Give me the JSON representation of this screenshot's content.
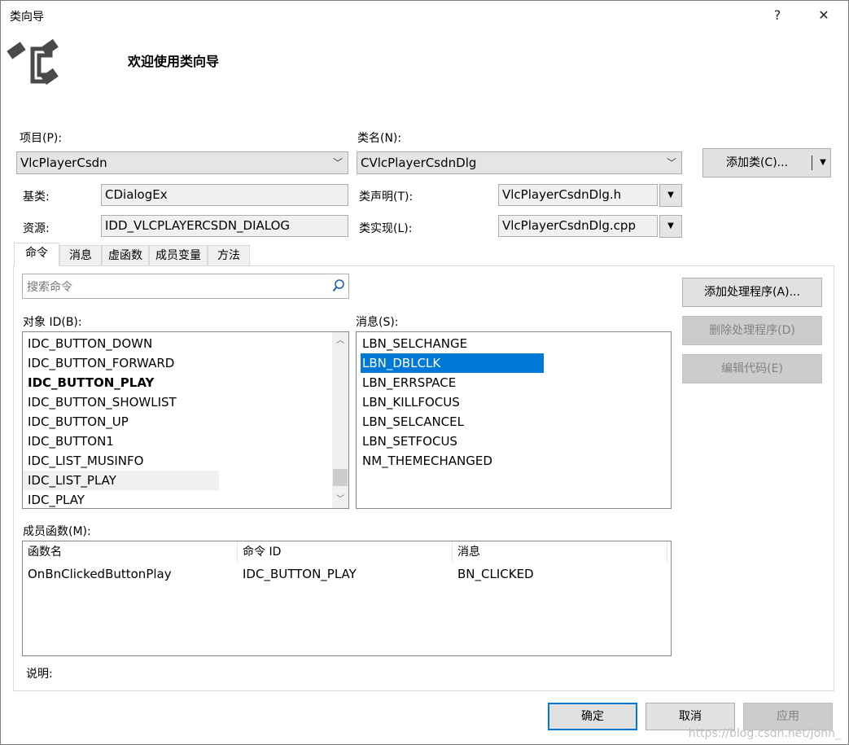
{
  "window": {
    "title": "类向导",
    "help_label": "?",
    "close_label": "✕",
    "heading": "欢迎使用类向导"
  },
  "project": {
    "label": "项目(P):",
    "value": "VlcPlayerCsdn"
  },
  "class_name": {
    "label": "类名(N):",
    "value": "CVlcPlayerCsdnDlg"
  },
  "add_class": {
    "label": "添加类(C)..."
  },
  "base_class": {
    "label": "基类:",
    "value": "CDialogEx"
  },
  "resource": {
    "label": "资源:",
    "value": "IDD_VLCPLAYERCSDN_DIALOG"
  },
  "class_decl": {
    "label": "类声明(T):",
    "value": "VlcPlayerCsdnDlg.h"
  },
  "class_impl": {
    "label": "类实现(L):",
    "value": "VlcPlayerCsdnDlg.cpp"
  },
  "tabs": [
    {
      "label": "命令",
      "active": true
    },
    {
      "label": "消息"
    },
    {
      "label": "虚函数"
    },
    {
      "label": "成员变量"
    },
    {
      "label": "方法"
    }
  ],
  "search": {
    "placeholder": "搜索命令"
  },
  "object_ids": {
    "label": "对象 ID(B):",
    "items": [
      "IDC_BUTTON_DOWN",
      "IDC_BUTTON_FORWARD",
      "IDC_BUTTON_PLAY",
      "IDC_BUTTON_SHOWLIST",
      "IDC_BUTTON_UP",
      "IDC_BUTTON1",
      "IDC_LIST_MUSINFO",
      "IDC_LIST_PLAY",
      "IDC_PLAY"
    ],
    "bold_item": "IDC_BUTTON_PLAY",
    "hover_item": "IDC_LIST_PLAY"
  },
  "messages": {
    "label": "消息(S):",
    "items": [
      "LBN_SELCHANGE",
      "LBN_DBLCLK",
      "LBN_ERRSPACE",
      "LBN_KILLFOCUS",
      "LBN_SELCANCEL",
      "LBN_SETFOCUS",
      "NM_THEMECHANGED"
    ],
    "selected_item": "LBN_DBLCLK"
  },
  "actions": {
    "add_handler": "添加处理程序(A)...",
    "delete_handler": "删除处理程序(D)",
    "edit_code": "编辑代码(E)"
  },
  "member_functions": {
    "label": "成员函数(M):",
    "columns": [
      "函数名",
      "命令 ID",
      "消息"
    ],
    "rows": [
      [
        "OnBnClickedButtonPlay",
        "IDC_BUTTON_PLAY",
        "BN_CLICKED"
      ]
    ]
  },
  "description": {
    "label": "说明:"
  },
  "footer": {
    "ok": "确定",
    "cancel": "取消",
    "apply": "应用",
    "watermark": "https://blog.csdn.net/Jonh_"
  },
  "colors": {
    "selection": "#0078d7",
    "default_button_border": "#0078d7"
  }
}
